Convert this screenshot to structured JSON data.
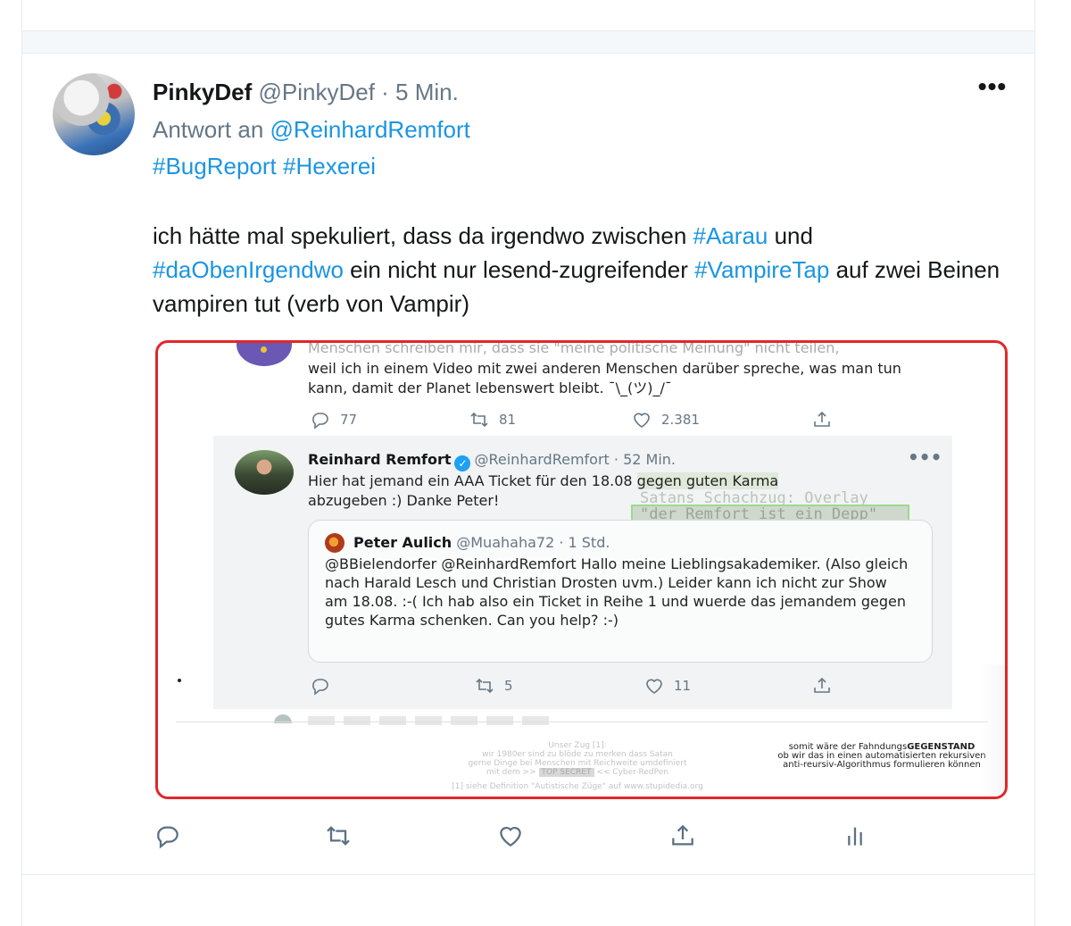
{
  "tweet": {
    "display_name": "PinkyDef",
    "handle": "@PinkyDef",
    "separator": " · ",
    "time": "5 Min.",
    "reply_prefix": "Antwort an ",
    "reply_to": "@ReinhardRemfort",
    "hashtags": [
      "#BugReport",
      "#Hexerei"
    ],
    "body": {
      "p1": "ich hätte mal spekuliert, dass da irgendwo zwischen ",
      "tag1": "#Aarau",
      "p2": " und ",
      "tag2": "#daObenIrgendwo",
      "p3": " ein nicht nur lesend-zugreifender ",
      "tag3": "#VampireTap",
      "p4": " auf zwei Beinen vampiren tut (verb von Vampir)"
    },
    "more_label": "•••"
  },
  "media": {
    "top_tweet": {
      "cut_line": "Menschen schreiben mir, dass sie \"meine politische Meinung\" nicht teilen,",
      "text": "weil ich in einem Video mit zwei anderen Menschen darüber spreche, was man tun kann, damit der Planet lebenswert bleibt. ¯\\_(ツ)_/¯",
      "replies": "77",
      "retweets": "81",
      "likes": "2.381"
    },
    "reply_tweet": {
      "name": "Reinhard Remfort",
      "handle": "@ReinhardRemfort",
      "time": " · 52 Min.",
      "more": "•••",
      "text_a": "Hier hat jemand ein AAA Ticket für den 18.08 ",
      "text_hl": "gegen guten Karma",
      "text_b": " abzugeben :) Danke Peter!",
      "replies": "",
      "retweets": "5",
      "likes": "11"
    },
    "overlay_line1": "Satans Schachzug: Overlay",
    "overlay_line2": "\"der Remfort ist ein Depp\"",
    "quoted": {
      "name": "Peter Aulich",
      "handle": "@Muahaha72",
      "time": " · 1 Std.",
      "text": "@BBielendorfer @ReinhardRemfort Hallo meine Lieblingsakademiker. (Also gleich nach Harald Lesch und Christian Drosten uvm.) Leider kann ich nicht zur Show am 18.08. :-( Ich hab also ein Ticket in Reihe 1 und wuerde das jemandem gegen gutes Karma schenken. Can you help? :-)"
    },
    "footnote": {
      "line1": "Unser Zug [1]:",
      "line2": "wir 1980er sind zu blöde zu merken dass Satan",
      "line3": "gerne Dinge bei Menschen mit Reichweite umdefiniert",
      "line4a": "mit dem >> ",
      "top_secret": "TOP SECRET",
      "line4b": " << Cyber-RedPen",
      "ref": "[1] siehe Definition \"Autistische Züge\" auf www.stupidedia.org"
    },
    "fahndung": {
      "a": "somit wäre der Fahndungs",
      "b": "GEGENSTAND",
      "c": "ob wir das in einen automatisierten rekursiven anti-reursiv-Algorithmus formulieren können"
    }
  },
  "colors": {
    "link": "#1b95e0",
    "media_border": "#e0282a",
    "text": "#14171a",
    "secondary": "#657786"
  },
  "icons": [
    "reply-icon",
    "retweet-icon",
    "like-icon",
    "share-icon",
    "analytics-icon",
    "verified-badge-icon",
    "more-icon"
  ]
}
